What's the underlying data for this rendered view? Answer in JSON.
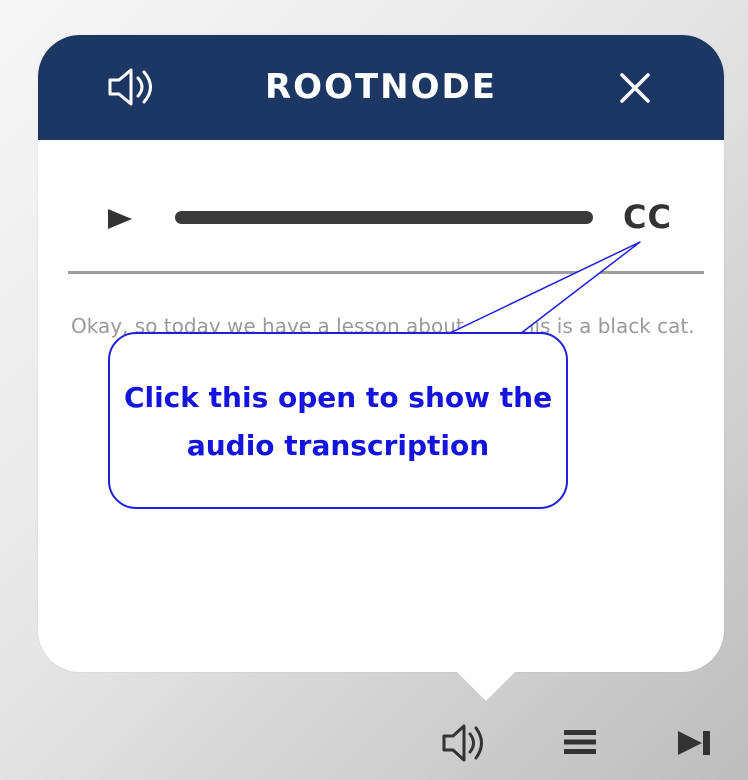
{
  "player": {
    "title": "ROOTNODE",
    "icons": {
      "header_speaker": "speaker-icon",
      "close": "close-icon",
      "play": "play-icon",
      "bottom_speaker": "speaker-icon",
      "menu": "menu-icon",
      "next": "skip-next-icon"
    },
    "cc_label": "CC",
    "transcript": "Okay, so today we have a lesson about cat, this is a black cat."
  },
  "callout": {
    "text": "Click this open to show the audio transcription"
  },
  "colors": {
    "header_bg": "#1c3764",
    "callout_border": "#1f1fdf",
    "callout_text": "#1414e0",
    "transcript_text": "#9a9a9a"
  }
}
